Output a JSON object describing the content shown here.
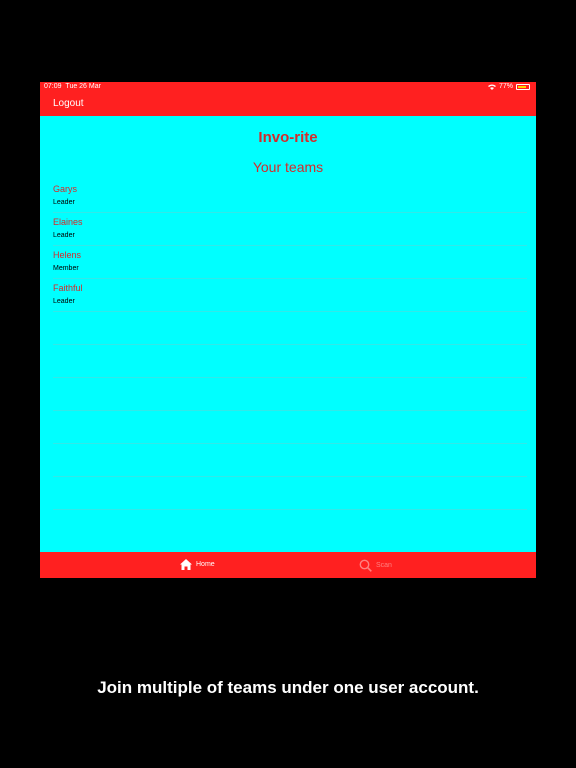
{
  "status_bar": {
    "time": "07:09",
    "date": "Tue 26 Mar",
    "battery": "77%"
  },
  "header": {
    "logout_label": "Logout"
  },
  "app": {
    "title": "Invo-rite",
    "section_title": "Your teams"
  },
  "teams": [
    {
      "name": "Garys",
      "role": "Leader"
    },
    {
      "name": "Elaines",
      "role": "Leader"
    },
    {
      "name": "Helens",
      "role": "Member"
    },
    {
      "name": "Faithful",
      "role": "Leader"
    }
  ],
  "tabs": [
    {
      "label": "Home",
      "icon": "home-icon",
      "active": true
    },
    {
      "label": "Scan",
      "icon": "search-icon",
      "active": false
    }
  ],
  "caption": "Join multiple of teams under one user account.",
  "colors": {
    "header": "#ff2020",
    "background": "#00ffff",
    "accent": "#d62a2a"
  }
}
